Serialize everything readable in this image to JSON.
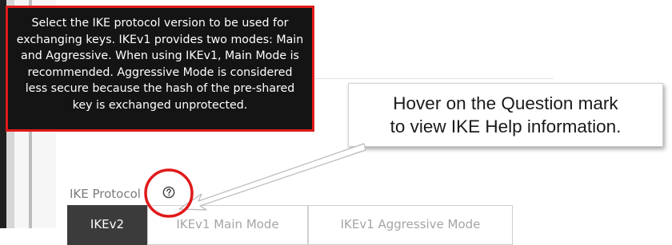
{
  "tooltip": {
    "lines": [
      "Select the IKE protocol version to be used for",
      "exchanging keys. IKEv1 provides two modes: Main",
      "and Aggressive. When using IKEv1, Main Mode is",
      "recommended. Aggressive Mode is considered",
      "less secure because the hash of the pre-shared",
      "key is exchanged unprotected."
    ]
  },
  "callout": {
    "lines": [
      "Hover on the Question mark",
      "to view IKE Help information."
    ]
  },
  "ike_protocol": {
    "label": "IKE Protocol",
    "help_icon": "question-circle-icon",
    "options": [
      "IKEv2",
      "IKEv1 Main Mode",
      "IKEv1 Aggressive Mode"
    ],
    "selected": "IKEv2"
  },
  "colors": {
    "highlight_red": "#e01a1a",
    "tooltip_bg": "#141414",
    "selected_bg": "#3b3b3b"
  }
}
